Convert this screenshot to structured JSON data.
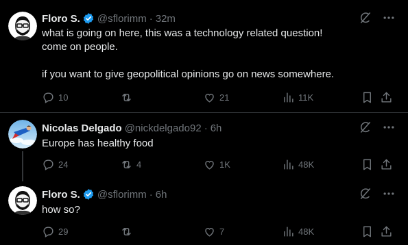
{
  "tweets": [
    {
      "name": "Floro S.",
      "handle": "@sflorimm",
      "separator": "·",
      "time": "32m",
      "text": [
        "what is going on here, this was a technology related question!",
        "come on people.",
        "",
        "if you want to give geopolitical opinions go on news somewhere."
      ],
      "stats": {
        "replies": "10",
        "reposts": "",
        "likes": "21",
        "views": "11K"
      }
    },
    {
      "name": "Nicolas Delgado",
      "handle": "@nickdelgado92",
      "separator": "·",
      "time": "6h",
      "text": [
        "Europe has healthy food"
      ],
      "stats": {
        "replies": "24",
        "reposts": "4",
        "likes": "1K",
        "views": "48K"
      }
    },
    {
      "name": "Floro S.",
      "handle": "@sflorimm",
      "separator": "·",
      "time": "6h",
      "text": [
        "how so?"
      ],
      "stats": {
        "replies": "29",
        "reposts": "",
        "likes": "7",
        "views": "48K"
      }
    }
  ],
  "colors": {
    "background": "#000000",
    "text": "#e7e9ea",
    "muted": "#71767b",
    "verified": "#1d9bf0",
    "divider": "#2f3336"
  },
  "icons": [
    "grok-icon",
    "more-icon",
    "reply-icon",
    "repost-icon",
    "like-icon",
    "views-icon",
    "bookmark-icon",
    "share-icon",
    "verified-badge-icon"
  ]
}
